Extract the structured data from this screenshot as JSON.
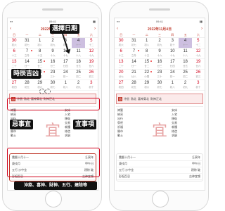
{
  "left_screen": {
    "status": {
      "carrier": "▪▪▪",
      "time": "09:41",
      "battery": "▮▮"
    },
    "header": {
      "prev": "‹",
      "title": "2022年11月4日",
      "next": "›"
    },
    "weekdays": [
      "日",
      "一",
      "二",
      "三",
      "四",
      "五",
      "六"
    ],
    "days": [
      {
        "n": "30",
        "l": "初六"
      },
      {
        "n": "31",
        "l": "初七"
      },
      {
        "n": "1",
        "l": "初八"
      },
      {
        "n": "2",
        "l": "初九"
      },
      {
        "n": "3",
        "l": "初十"
      },
      {
        "n": "4",
        "l": "十一"
      },
      {
        "n": "5",
        "l": "十二"
      },
      {
        "n": "6",
        "l": "十三"
      },
      {
        "n": "7",
        "l": "立冬"
      },
      {
        "n": "8",
        "l": "十五"
      },
      {
        "n": "9",
        "l": "十六"
      },
      {
        "n": "10",
        "l": "十七"
      },
      {
        "n": "11",
        "l": "十八"
      },
      {
        "n": "12",
        "l": "十九"
      },
      {
        "n": "13",
        "l": "二十"
      },
      {
        "n": "14",
        "l": "廿一"
      },
      {
        "n": "15",
        "l": "廿二"
      },
      {
        "n": "16",
        "l": "廿三"
      },
      {
        "n": "17",
        "l": "廿四"
      },
      {
        "n": "18",
        "l": "廿五"
      },
      {
        "n": "19",
        "l": "廿六"
      },
      {
        "n": "20",
        "l": "廿七"
      },
      {
        "n": "21",
        "l": "廿八"
      },
      {
        "n": "22",
        "l": "小雪"
      },
      {
        "n": "23",
        "l": "三十"
      },
      {
        "n": "24",
        "l": "初一"
      },
      {
        "n": "25",
        "l": "初二"
      },
      {
        "n": "26",
        "l": "初三"
      },
      {
        "n": "27",
        "l": "初四"
      },
      {
        "n": "28",
        "l": "初五"
      },
      {
        "n": "29",
        "l": "初六"
      },
      {
        "n": "30",
        "l": "初七"
      },
      {
        "n": "1",
        "l": "初八"
      },
      {
        "n": "2",
        "l": "初九"
      },
      {
        "n": "3",
        "l": "初十"
      }
    ],
    "info_bar": {
      "tag": "吉",
      "items": [
        "沖鼠",
        "煞北",
        "喜神東北",
        "財神正北"
      ]
    },
    "detail": {
      "left": [
        "嫁娶",
        "納采",
        "出行",
        "祭祀",
        "祈福",
        "開市",
        "動土"
      ],
      "mid": "宜",
      "right": [
        "安床",
        "入宅",
        "移徙",
        "交易",
        "栽種",
        "修造",
        "求嗣"
      ]
    },
    "list": [
      {
        "a": "農曆十月十一",
        "b": "壬寅年"
      },
      {
        "a": "庚戌月",
        "b": "甲午日"
      },
      {
        "a": "五行 沙中金",
        "b": "建除 破"
      },
      {
        "a": "彭祖百忌",
        "b": "吉神宜趨"
      }
    ]
  },
  "right_screen": {
    "status": {
      "carrier": "▪▪▪",
      "time": "09:41",
      "battery": "▮▮"
    },
    "header": {
      "prev": "‹",
      "title": "2022年11月4日",
      "next": "›"
    },
    "weekdays": [
      "日",
      "一",
      "二",
      "三",
      "四",
      "五",
      "六"
    ],
    "days": [
      {
        "n": "30",
        "l": "初六"
      },
      {
        "n": "31",
        "l": "初七"
      },
      {
        "n": "1",
        "l": "初八"
      },
      {
        "n": "2",
        "l": "初九"
      },
      {
        "n": "3",
        "l": "初十"
      },
      {
        "n": "4",
        "l": "十一"
      },
      {
        "n": "5",
        "l": "十二"
      },
      {
        "n": "6",
        "l": "十三"
      },
      {
        "n": "7",
        "l": "立冬"
      },
      {
        "n": "8",
        "l": "十五"
      },
      {
        "n": "9",
        "l": "十六"
      },
      {
        "n": "10",
        "l": "十七"
      },
      {
        "n": "11",
        "l": "十八"
      },
      {
        "n": "12",
        "l": "十九"
      },
      {
        "n": "13",
        "l": "二十"
      },
      {
        "n": "14",
        "l": "廿一"
      },
      {
        "n": "15",
        "l": "廿二"
      },
      {
        "n": "16",
        "l": "廿三"
      },
      {
        "n": "17",
        "l": "廿四"
      },
      {
        "n": "18",
        "l": "廿五"
      },
      {
        "n": "19",
        "l": "廿六"
      },
      {
        "n": "20",
        "l": "廿七"
      },
      {
        "n": "21",
        "l": "廿八"
      },
      {
        "n": "22",
        "l": "小雪"
      },
      {
        "n": "23",
        "l": "三十"
      },
      {
        "n": "24",
        "l": "初一"
      },
      {
        "n": "25",
        "l": "初二"
      },
      {
        "n": "26",
        "l": "初三"
      },
      {
        "n": "27",
        "l": "初四"
      },
      {
        "n": "28",
        "l": "初五"
      },
      {
        "n": "29",
        "l": "初六"
      },
      {
        "n": "30",
        "l": "初七"
      },
      {
        "n": "1",
        "l": "初八"
      },
      {
        "n": "2",
        "l": "初九"
      },
      {
        "n": "3",
        "l": "初十"
      }
    ],
    "info_bar": {
      "tag": "吉",
      "items": [
        "沖鼠",
        "煞北",
        "喜神東北",
        "財神正北"
      ]
    },
    "detail": {
      "left": [
        "嫁娶",
        "納采",
        "出行",
        "祭祀",
        "祈福",
        "開市",
        "動土"
      ],
      "mid": "宜",
      "right": [
        "安床",
        "入宅",
        "移徙",
        "交易",
        "栽種",
        "修造",
        "求嗣"
      ]
    },
    "list": [
      {
        "a": "農曆十月十一",
        "b": "壬寅年"
      },
      {
        "a": "庚戌月",
        "b": "甲午日"
      },
      {
        "a": "五行 沙中金",
        "b": "建除 破"
      },
      {
        "a": "彭祖百忌",
        "b": "吉神宜趨"
      }
    ]
  },
  "callouts": {
    "date_select": "選擇日期",
    "lucky_time": "時辰吉凶",
    "avoid": "忌事宜",
    "suitable": "宜事項",
    "bottom_note": "沖煞、喜神、財神、五行、建除等"
  },
  "colors": {
    "accent": "#c0392b",
    "today": "#cdbfe0",
    "callout_bg": "#111111"
  }
}
